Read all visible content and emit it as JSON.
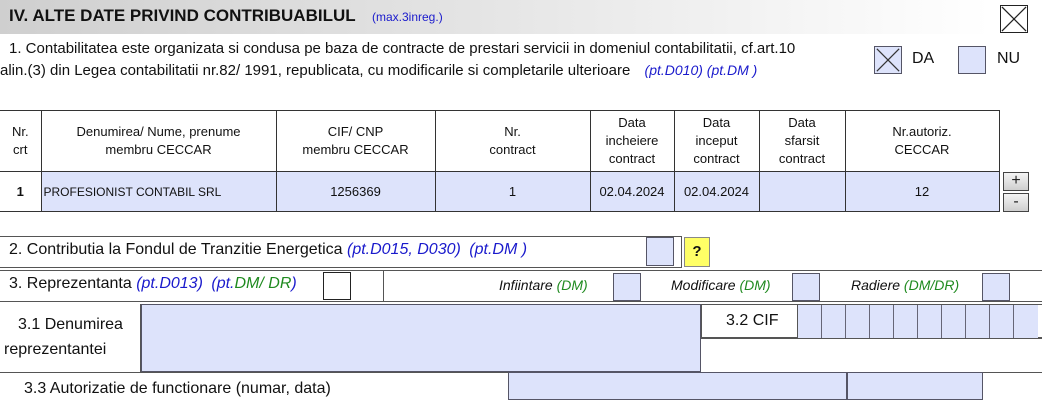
{
  "section": {
    "title": "IV. ALTE DATE PRIVIND CONTRIBUABILUL",
    "subtitle": "(max.3inreg.)"
  },
  "q1": {
    "line1": "1. Contabilitatea este organizata si condusa pe baza de contracte de prestari servicii in domeniul contabilitatii, cf.art.10",
    "line2": "alin.(3) din Legea contabilitatii nr.82/ 1991, republicata, cu modificarile si completarile ulterioare",
    "ref": "(pt.D010) (pt.DM )",
    "da_label": "DA",
    "nu_label": "NU",
    "da_checked": true,
    "nu_checked": false
  },
  "table": {
    "headers": [
      [
        "Nr.",
        "crt"
      ],
      [
        "Denumirea/ Nume, prenume",
        "membru CECCAR"
      ],
      [
        "CIF/ CNP",
        "membru CECCAR"
      ],
      [
        "Nr.",
        "contract"
      ],
      [
        "Data",
        "incheiere",
        "contract"
      ],
      [
        "Data",
        "inceput",
        "contract"
      ],
      [
        "Data",
        "sfarsit",
        "contract"
      ],
      [
        "Nr.autoriz.",
        "CECCAR"
      ]
    ],
    "rows": [
      [
        "1",
        "PROFESIONIST CONTABIL SRL",
        "1256369",
        "1",
        "02.04.2024",
        "02.04.2024",
        "",
        "12"
      ]
    ],
    "add_label": "+",
    "remove_label": "-"
  },
  "q2": {
    "label": "2. Contributia la Fondul de Tranzitie Energetica",
    "ref1": "(pt.D015, D030)",
    "ref2": "(pt.DM )",
    "help_label": "?"
  },
  "q3": {
    "label": "3. Reprezentanta",
    "ref1": "(pt.D013)",
    "ref2_prefix": "(pt.",
    "ref2_green": "DM/ DR",
    "ref2_suffix": ")",
    "infiintare": "Infiintare",
    "infiintare_tag": "(DM)",
    "modificare": "Modificare",
    "modificare_tag": "(DM)",
    "radiere": "Radiere",
    "radiere_tag": "(DM/DR)"
  },
  "q31": {
    "line1": "3.1 Denumirea",
    "line2": "reprezentantei",
    "cif_label": "3.2 CIF"
  },
  "q33": {
    "label": "3.3 Autorizatie de functionare  (numar, data)"
  },
  "colors": {
    "field_fill": "#dde3fb",
    "ref_blue": "#1a1acc",
    "ref_green": "#1f8a1f",
    "help_yellow": "#ffff66"
  }
}
